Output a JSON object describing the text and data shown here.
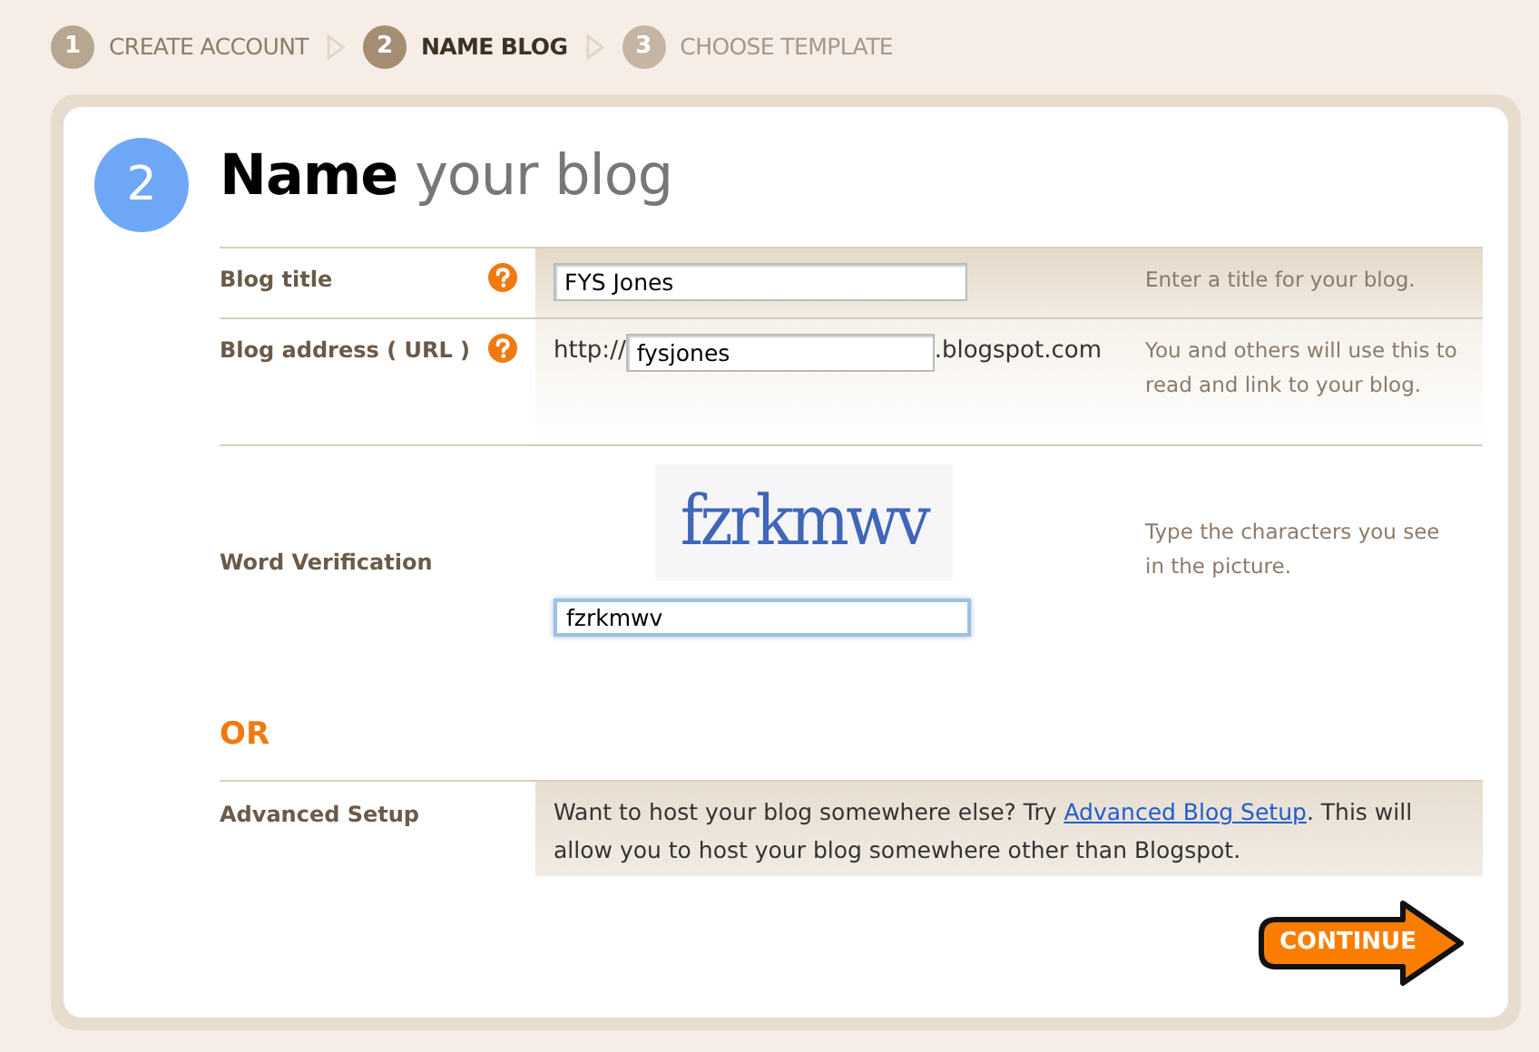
{
  "steps": [
    {
      "number": "1",
      "label": "CREATE ACCOUNT",
      "selected": false,
      "completed": true
    },
    {
      "number": "2",
      "label": "NAME BLOG",
      "selected": true,
      "completed": false
    },
    {
      "number": "3",
      "label": "CHOOSE TEMPLATE",
      "selected": false,
      "completed": false
    }
  ],
  "heading": {
    "number": "2",
    "strong": "Name",
    "rest": "your blog"
  },
  "fields": [
    {
      "kind": "text",
      "label": "Blog title",
      "help": true,
      "value": "FYS Jones",
      "hint": "Enter a title for your blog."
    },
    {
      "kind": "url",
      "label": "Blog address ( URL )",
      "help": true,
      "prefix": "http://",
      "value": "fysjones",
      "suffix": ".blogspot.com",
      "hint": "You and others will use this to read and link to your blog."
    },
    {
      "kind": "captcha",
      "label": "Word Verification",
      "help": false,
      "captcha_text": "fzrkmwv",
      "value": "fzrkmwv",
      "focused": true,
      "hint": "Type the characters you see in the picture."
    }
  ],
  "or_label": "OR",
  "advanced": {
    "label": "Advanced Setup",
    "text_before": "Want to host your blog somewhere else? Try ",
    "link": "Advanced Blog Setup",
    "text_after": ". This will allow you to host your blog somewhere other than Blogspot."
  },
  "continue_button": "CONTINUE"
}
